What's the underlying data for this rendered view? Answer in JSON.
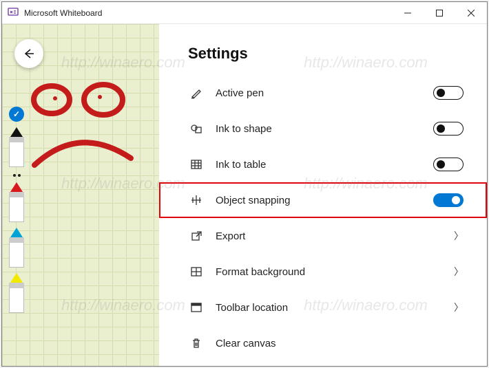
{
  "window": {
    "title": "Microsoft Whiteboard"
  },
  "panel": {
    "heading": "Settings",
    "rows": [
      {
        "id": "active-pen",
        "label": "Active pen",
        "type": "toggle",
        "on": false
      },
      {
        "id": "ink-to-shape",
        "label": "Ink to shape",
        "type": "toggle",
        "on": false
      },
      {
        "id": "ink-to-table",
        "label": "Ink to table",
        "type": "toggle",
        "on": false
      },
      {
        "id": "object-snapping",
        "label": "Object snapping",
        "type": "toggle",
        "on": true,
        "highlight": true
      },
      {
        "id": "export",
        "label": "Export",
        "type": "nav"
      },
      {
        "id": "format-background",
        "label": "Format background",
        "type": "nav"
      },
      {
        "id": "toolbar-location",
        "label": "Toolbar location",
        "type": "nav"
      },
      {
        "id": "clear-canvas",
        "label": "Clear canvas",
        "type": "action"
      }
    ]
  },
  "toolbelt": {
    "selected": "black-pen",
    "pens": [
      "black-pen",
      "red-pen",
      "cyan-pen",
      "highlighter-pen"
    ]
  },
  "watermark": "http://winaero.com",
  "colors": {
    "accent": "#0078d4",
    "highlight_border": "#e3030b"
  }
}
